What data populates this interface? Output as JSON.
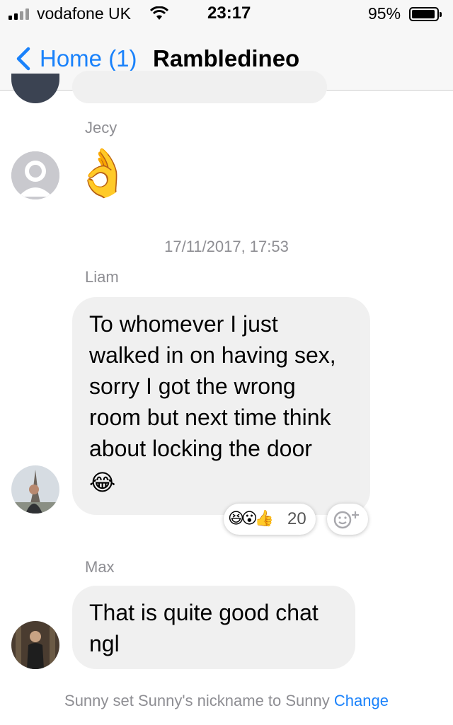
{
  "status_bar": {
    "carrier": "vodafone UK",
    "time": "23:17",
    "battery": "95%",
    "signal_icon": "signal-bars-icon",
    "wifi_icon": "wifi-icon",
    "battery_icon": "battery-icon"
  },
  "nav": {
    "back_label": "Home (1)",
    "title": "Rambledineo"
  },
  "chat": {
    "messages": [
      {
        "sender": "Jecy",
        "text": "👌"
      },
      {
        "timestamp": "17/11/2017, 17:53"
      },
      {
        "sender": "Liam",
        "text": "To whomever I just walked in on having sex, sorry I got the wrong room but next time think about locking the door",
        "emoji": "😂",
        "reactions": {
          "emojis": "😆😮👍",
          "count": "20"
        }
      },
      {
        "sender": "Max",
        "text": "That is quite good chat ngl"
      }
    ],
    "system_message": {
      "text": "Sunny set Sunny's nickname to Sunny",
      "action": "Change"
    }
  },
  "colors": {
    "accent": "#1a82fb",
    "bubble": "#f0f0f0",
    "meta_text": "#8e8e93"
  }
}
